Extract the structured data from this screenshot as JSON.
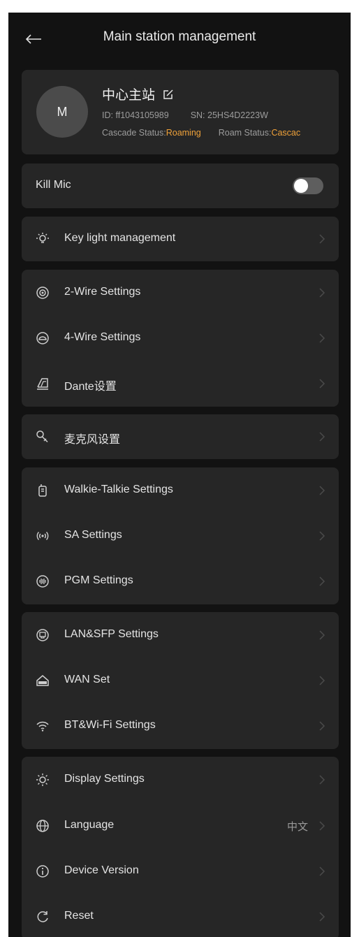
{
  "header": {
    "title": "Main station management",
    "back_icon": "arrow-left-icon"
  },
  "profile": {
    "avatar_letter": "M",
    "name": "中心主站",
    "id_label": "ID:",
    "id_value": "ff1043105989",
    "sn_label": "SN:",
    "sn_value": "25HS4D2223W",
    "cascade_label": "Cascade Status:",
    "cascade_value": "Roaming",
    "roam_label": "Roam Status:",
    "roam_value": "Cascac"
  },
  "kill_mic": {
    "label": "Kill Mic",
    "enabled": false
  },
  "groups": [
    {
      "items": [
        {
          "label": "Key light management",
          "icon": "lightbulb-icon"
        }
      ]
    },
    {
      "items": [
        {
          "label": "2-Wire Settings",
          "icon": "two-wire-icon"
        },
        {
          "label": "4-Wire Settings",
          "icon": "four-wire-icon"
        },
        {
          "label": "Dante设置",
          "icon": "dante-icon"
        }
      ]
    },
    {
      "items": [
        {
          "label": "麦克风设置",
          "icon": "microphone-icon"
        }
      ]
    },
    {
      "items": [
        {
          "label": "Walkie-Talkie Settings",
          "icon": "walkie-talkie-icon"
        },
        {
          "label": "SA Settings",
          "icon": "sa-broadcast-icon"
        },
        {
          "label": "PGM Settings",
          "icon": "pgm-icon"
        }
      ]
    },
    {
      "items": [
        {
          "label": "LAN&SFP Settings",
          "icon": "lan-icon"
        },
        {
          "label": "WAN Set",
          "icon": "wan-icon"
        },
        {
          "label": "BT&Wi-Fi Settings",
          "icon": "wifi-icon"
        }
      ]
    },
    {
      "items": [
        {
          "label": "Display Settings",
          "icon": "display-brightness-icon"
        },
        {
          "label": "Language",
          "icon": "globe-icon",
          "value": "中文"
        },
        {
          "label": "Device Version",
          "icon": "info-icon"
        },
        {
          "label": "Reset",
          "icon": "reset-icon"
        }
      ]
    }
  ],
  "colors": {
    "background": "#121212",
    "card": "#262626",
    "accent": "#f0a23a",
    "text": "#e4e4e4"
  }
}
